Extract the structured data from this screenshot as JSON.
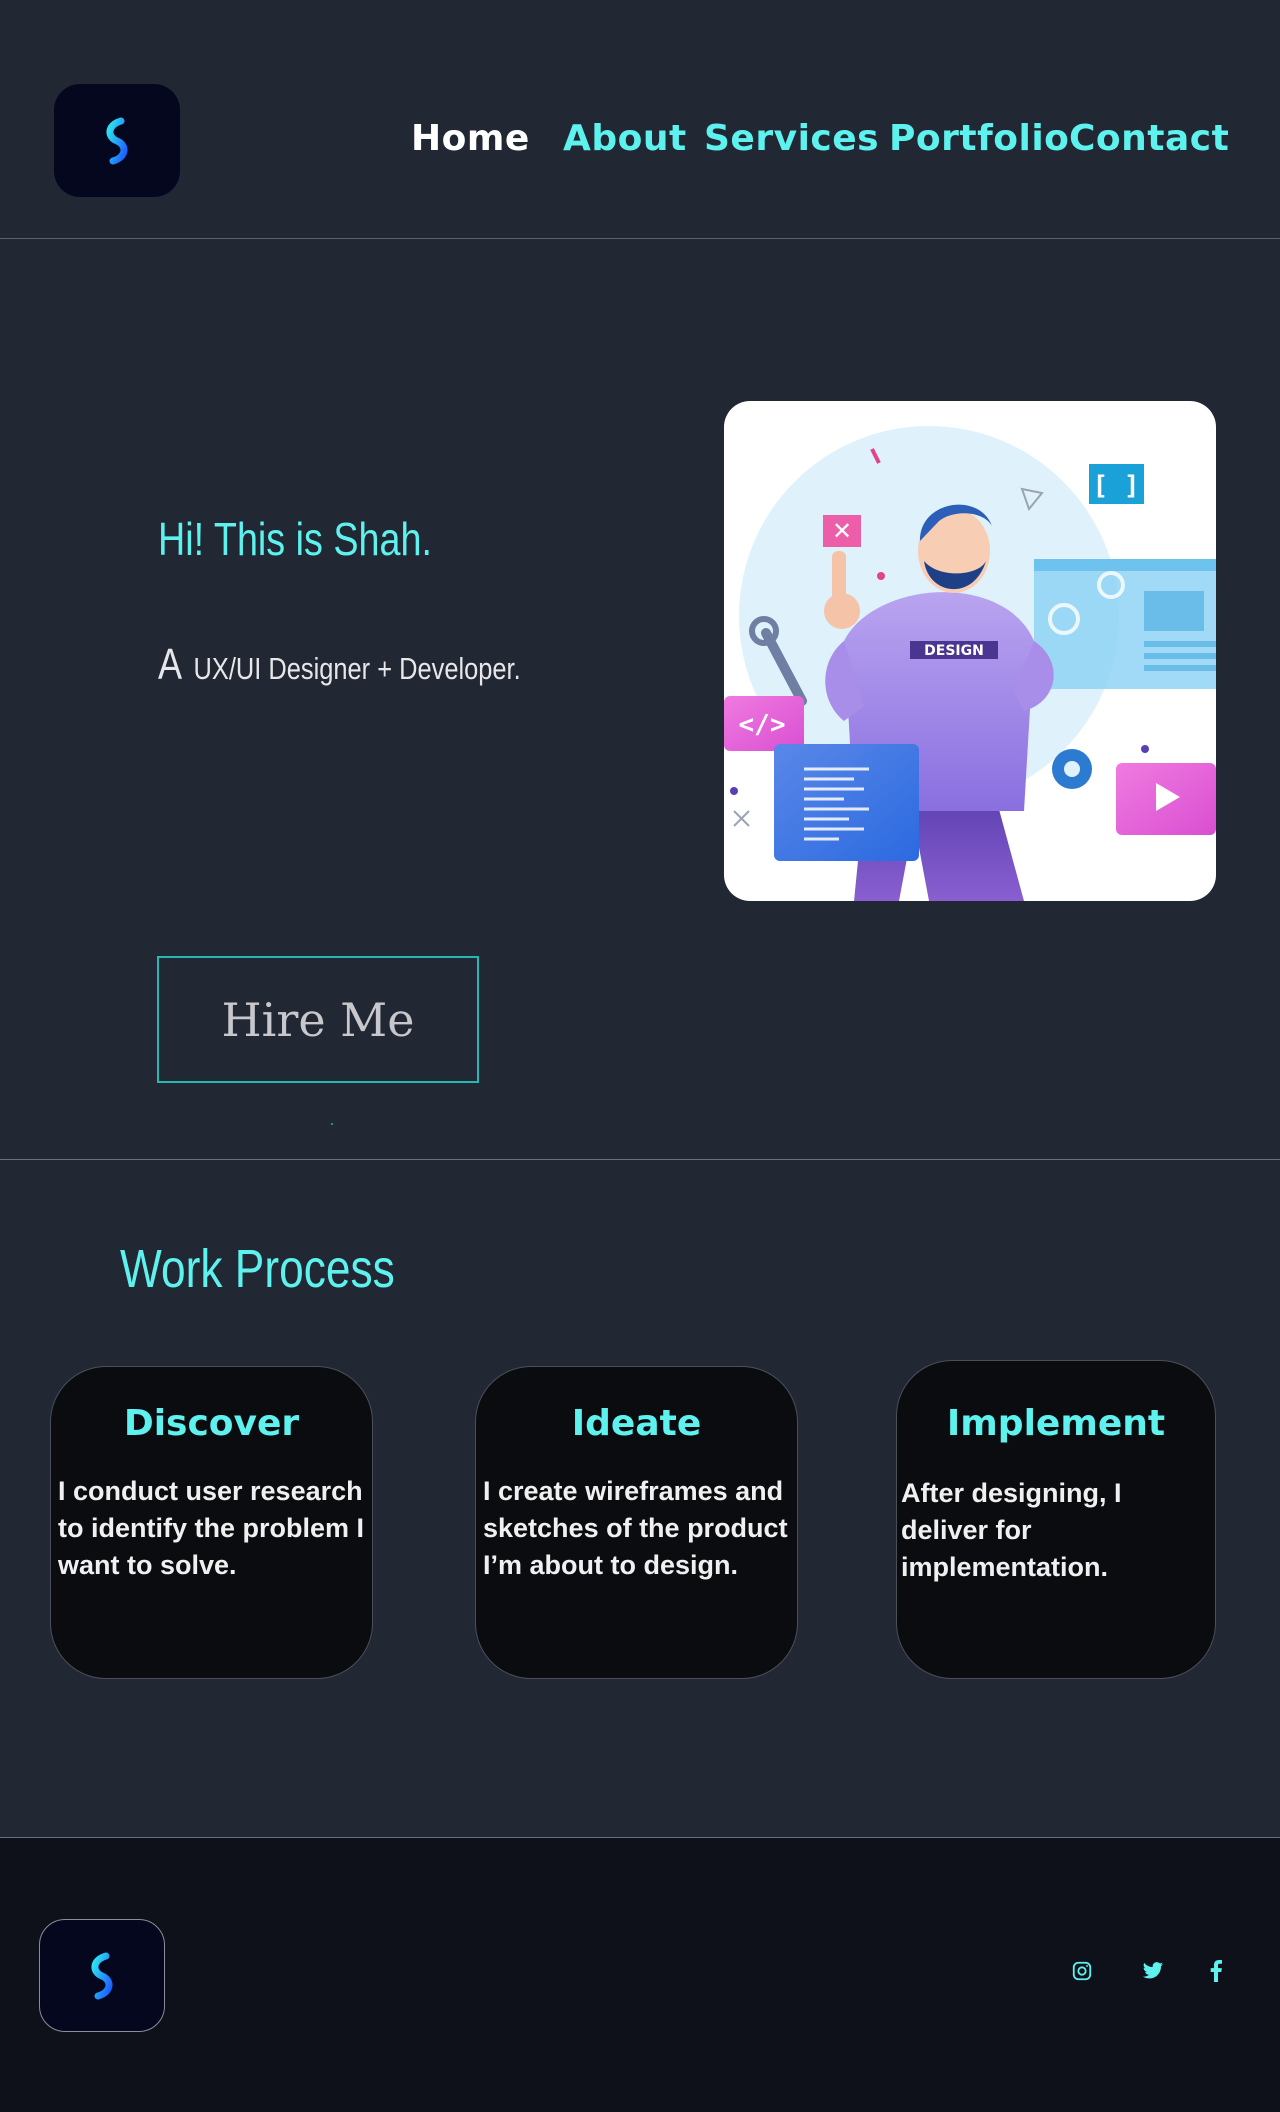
{
  "nav": {
    "home": "Home",
    "about": "About",
    "services": "Services",
    "portfolio": "Portfolio",
    "contact": "Contact"
  },
  "hero": {
    "greeting": "Hi! This is Shah.",
    "role_article": "A",
    "role_text": "UX/UI Designer + Developer.",
    "illustration_badge": "DESIGN",
    "hire_button": "Hire Me"
  },
  "process": {
    "title": "Work Process",
    "cards": [
      {
        "title": "Discover",
        "text": "I conduct user research to identify the problem I want to solve."
      },
      {
        "title": "Ideate",
        "text": "I create wireframes and sketches of the product I’m about to design."
      },
      {
        "title": "Implement",
        "text": "After designing, I deliver for implementation."
      }
    ]
  },
  "footer": {
    "social": [
      "instagram-icon",
      "twitter-icon",
      "facebook-icon"
    ]
  },
  "colors": {
    "background": "#212733",
    "accent": "#5ef2ef",
    "card": "#0b0c10",
    "footer": "#0e111a"
  }
}
